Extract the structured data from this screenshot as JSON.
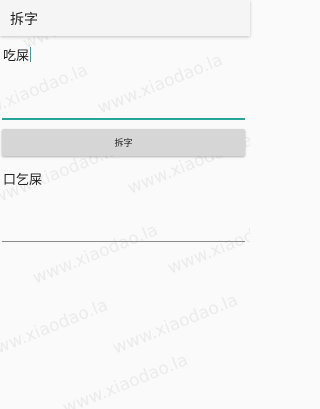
{
  "app_bar": {
    "title": "拆字"
  },
  "input": {
    "value": "吃屎"
  },
  "split_button": {
    "label": "拆字"
  },
  "result": {
    "value": "口乞屎"
  },
  "watermark": {
    "text": "www.xiaodao.la"
  },
  "colors": {
    "accent": "#26a69a",
    "background": "#fafafa",
    "app_bar": "#f5f5f5",
    "button": "#d6d6d6",
    "text": "#212121"
  }
}
